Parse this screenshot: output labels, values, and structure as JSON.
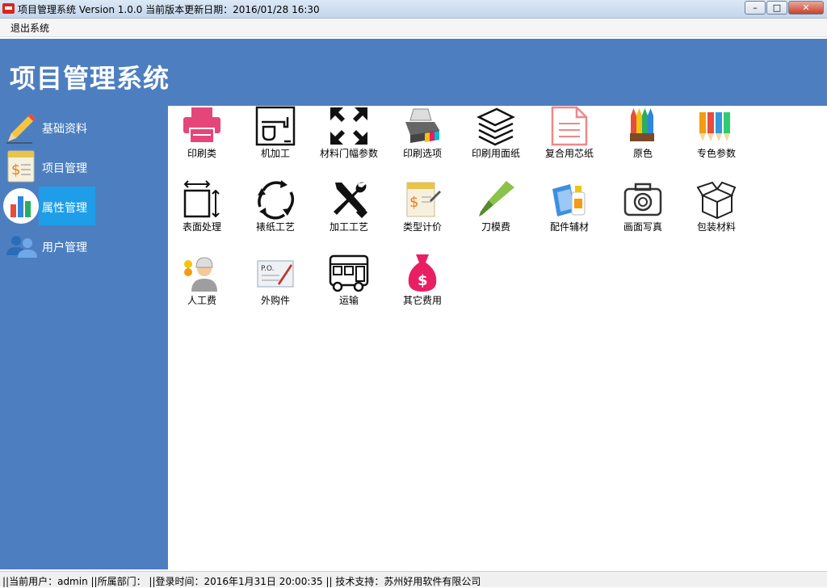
{
  "window": {
    "title": "项目管理系统 Version 1.0.0 当前版本更新日期：2016/01/28 16:30",
    "min_symbol": "–",
    "max_symbol": "□",
    "close_symbol": "✕"
  },
  "menu": {
    "exit_label": "退出系统"
  },
  "header": {
    "title": "项目管理系统",
    "bg_color": "#4d7fc0"
  },
  "sidebar": {
    "items": [
      {
        "label": "基础资料",
        "icon": "pencil-icon"
      },
      {
        "label": "项目管理",
        "icon": "document-dollar-icon"
      },
      {
        "label": "属性管理",
        "icon": "bar-chart-icon",
        "active": true
      },
      {
        "label": "用户管理",
        "icon": "users-icon"
      }
    ]
  },
  "tiles": [
    {
      "label": "印刷类",
      "icon": "printer-icon"
    },
    {
      "label": "机加工",
      "icon": "coffee-machine-icon"
    },
    {
      "label": "材料门幅参数",
      "icon": "expand-arrows-icon"
    },
    {
      "label": "印刷选项",
      "icon": "color-printer-icon"
    },
    {
      "label": "印刷用面纸",
      "icon": "paper-stack-icon"
    },
    {
      "label": "复合用芯纸",
      "icon": "document-icon"
    },
    {
      "label": "原色",
      "icon": "crayons-icon"
    },
    {
      "label": "专色参数",
      "icon": "color-pencils-icon"
    },
    {
      "label": "表面处理",
      "icon": "dimension-box-icon"
    },
    {
      "label": "裱纸工艺",
      "icon": "refresh-cycle-icon"
    },
    {
      "label": "加工工艺",
      "icon": "tools-icon"
    },
    {
      "label": "类型计价",
      "icon": "price-document-icon"
    },
    {
      "label": "刀模费",
      "icon": "green-knife-icon"
    },
    {
      "label": "配件辅材",
      "icon": "glue-paper-icon"
    },
    {
      "label": "画面写真",
      "icon": "camera-icon"
    },
    {
      "label": "包装材料",
      "icon": "open-box-icon"
    },
    {
      "label": "人工费",
      "icon": "worker-icon"
    },
    {
      "label": "外购件",
      "icon": "purchase-order-icon"
    },
    {
      "label": "运输",
      "icon": "bus-icon"
    },
    {
      "label": "其它费用",
      "icon": "money-bag-icon"
    }
  ],
  "status": {
    "text": "||当前用户：admin  ||所属部门：  ||登录时间：2016年1月31日 20:00:35 || 技术支持：苏州好用软件有限公司"
  }
}
